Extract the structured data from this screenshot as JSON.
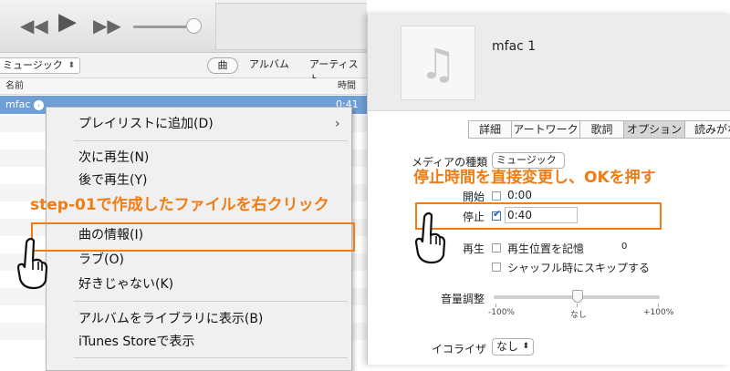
{
  "player": {
    "prev_icon": "rewind-icon",
    "play_icon": "play-icon",
    "next_icon": "fast-forward-icon",
    "prev_glyph": "◀◀",
    "play_glyph": "▶",
    "next_glyph": "▶▶"
  },
  "nav": {
    "media_kind": "ミュージック",
    "media_arrow": "⬍",
    "tabs": [
      "曲",
      "アルバム",
      "アーティスト"
    ]
  },
  "song_list": {
    "columns": {
      "name": "名前",
      "time": "時間"
    },
    "rows": [
      {
        "name": "mfac",
        "time": "0:41"
      }
    ]
  },
  "context_menu": {
    "items": [
      "プレイリストに追加(D)",
      "次に再生(N)",
      "後で再生(Y)",
      "曲の情報(I)",
      "ラブ(O)",
      "好きじゃない(K)",
      "アルバムをライブラリに表示(B)",
      "iTunes Storeで表示"
    ],
    "submenu_arrow": "›"
  },
  "info_panel": {
    "title": "mfac 1",
    "artwork_icon": "music-note-icon",
    "artwork_glyph": "♫",
    "tabs": [
      "詳細",
      "アートワーク",
      "歌詞",
      "オプション",
      "読みがな"
    ],
    "active_tab": "オプション",
    "media_kind_label": "メディアの種類",
    "media_kind_value": "ミュージック",
    "start_label": "開始",
    "start_checked": false,
    "start_value": "0:00",
    "stop_label": "停止",
    "stop_checked": true,
    "stop_value": "0:40",
    "playback_label": "再生",
    "remember_position": "再生位置を記憶",
    "skip_shuffle": "シャッフル時にスキップする",
    "volume_label": "音量調整",
    "volume_min": "-100%",
    "volume_mid": "なし",
    "volume_max": "+100%",
    "volume_adjust_percent": 0,
    "eq_label": "イコライザ",
    "eq_value": "なし",
    "stray_mark": "0"
  },
  "annotations": {
    "step_text": "step-01で作成したファイルを右クリック",
    "stop_text": "停止時間を直接変更し、OKを押す",
    "accent_color": "#f07c14",
    "left_hand_icon": "pointing-hand-icon",
    "right_hand_icon": "pointing-hand-icon"
  }
}
